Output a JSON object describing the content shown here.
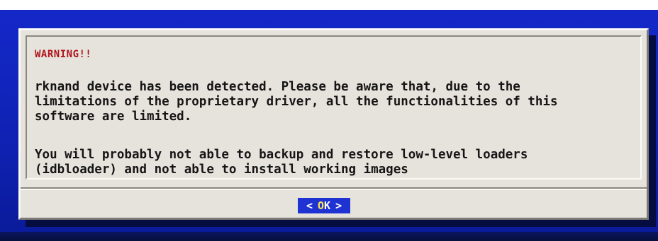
{
  "dialog": {
    "title": "WARNING!!",
    "paragraph_1": "rknand device has been detected. Please be aware that, due to the\nlimitations of the proprietary driver, all the functionalities of this\nsoftware are limited.",
    "paragraph_2": "You will probably not able to backup and restore low-level loaders\n(idbloader) and not able to install working images",
    "ok_button": {
      "left_bracket": "<",
      "label": "OK",
      "right_bracket": ">"
    }
  },
  "colors": {
    "screen_background": "#1428c8",
    "dialog_background": "#e6e2dc",
    "warning_title": "#b0151c",
    "button_background": "#1f33d2",
    "button_hotkey": "#ffe54a"
  }
}
